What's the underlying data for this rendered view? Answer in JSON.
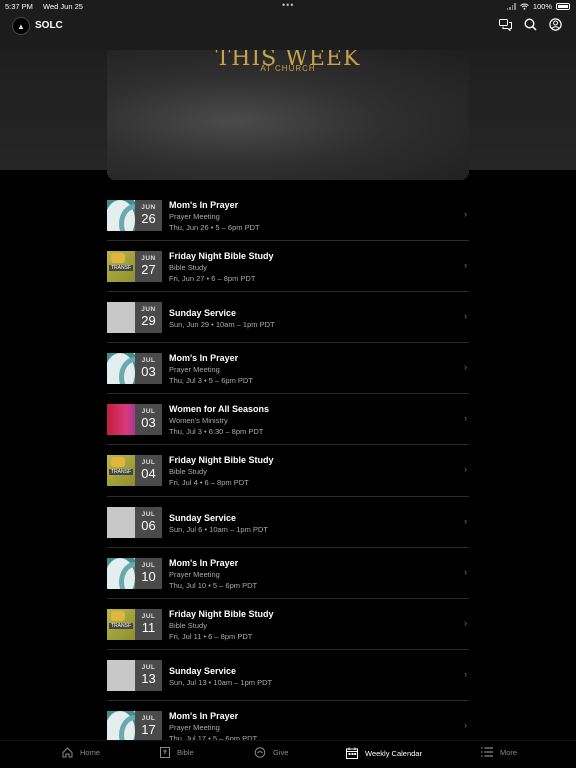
{
  "status": {
    "time": "5:37 PM",
    "date": "Wed Jun 25",
    "battery": "100%"
  },
  "app": {
    "name": "SOLC"
  },
  "hero": {
    "title": "THIS WEEK",
    "subtitle": "AT CHURCH"
  },
  "events": [
    {
      "title": "Mom's In Prayer",
      "category": "Prayer Meeting",
      "when": "Thu, Jun 26 • 5 – 6pm PDT",
      "month": "JUN",
      "day": "26",
      "art": "prayer"
    },
    {
      "title": "Friday Night Bible Study",
      "category": "Bible Study",
      "when": "Fri, Jun 27 • 6 – 8pm PDT",
      "month": "JUN",
      "day": "27",
      "art": "bible"
    },
    {
      "title": "Sunday Service",
      "category": "",
      "when": "Sun, Jun 29 • 10am – 1pm PDT",
      "month": "JUN",
      "day": "29",
      "art": "sunday"
    },
    {
      "title": "Mom's In Prayer",
      "category": "Prayer Meeting",
      "when": "Thu, Jul 3 • 5 – 6pm PDT",
      "month": "JUL",
      "day": "03",
      "art": "prayer"
    },
    {
      "title": "Women for All Seasons",
      "category": "Women's Ministry",
      "when": "Thu, Jul 3 • 6:30 – 8pm PDT",
      "month": "JUL",
      "day": "03",
      "art": "women"
    },
    {
      "title": "Friday Night Bible Study",
      "category": "Bible Study",
      "when": "Fri, Jul 4 • 6 – 8pm PDT",
      "month": "JUL",
      "day": "04",
      "art": "bible"
    },
    {
      "title": "Sunday Service",
      "category": "",
      "when": "Sun, Jul 6 • 10am – 1pm PDT",
      "month": "JUL",
      "day": "06",
      "art": "sunday"
    },
    {
      "title": "Mom's In Prayer",
      "category": "Prayer Meeting",
      "when": "Thu, Jul 10 • 5 – 6pm PDT",
      "month": "JUL",
      "day": "10",
      "art": "prayer"
    },
    {
      "title": "Friday Night Bible Study",
      "category": "Bible Study",
      "when": "Fri, Jul 11 • 6 – 8pm PDT",
      "month": "JUL",
      "day": "11",
      "art": "bible"
    },
    {
      "title": "Sunday Service",
      "category": "",
      "when": "Sun, Jul 13 • 10am – 1pm PDT",
      "month": "JUL",
      "day": "13",
      "art": "sunday"
    },
    {
      "title": "Mom's In Prayer",
      "category": "Prayer Meeting",
      "when": "Thu, Jul 17 • 5 – 6pm PDT",
      "month": "JUL",
      "day": "17",
      "art": "prayer"
    }
  ],
  "tabs": [
    {
      "label": "Home",
      "icon": "home-icon"
    },
    {
      "label": "Bible",
      "icon": "bible-icon"
    },
    {
      "label": "Give",
      "icon": "give-icon"
    },
    {
      "label": "Weekly Calendar",
      "icon": "calendar-icon",
      "active": true
    },
    {
      "label": "More",
      "icon": "list-icon"
    }
  ]
}
